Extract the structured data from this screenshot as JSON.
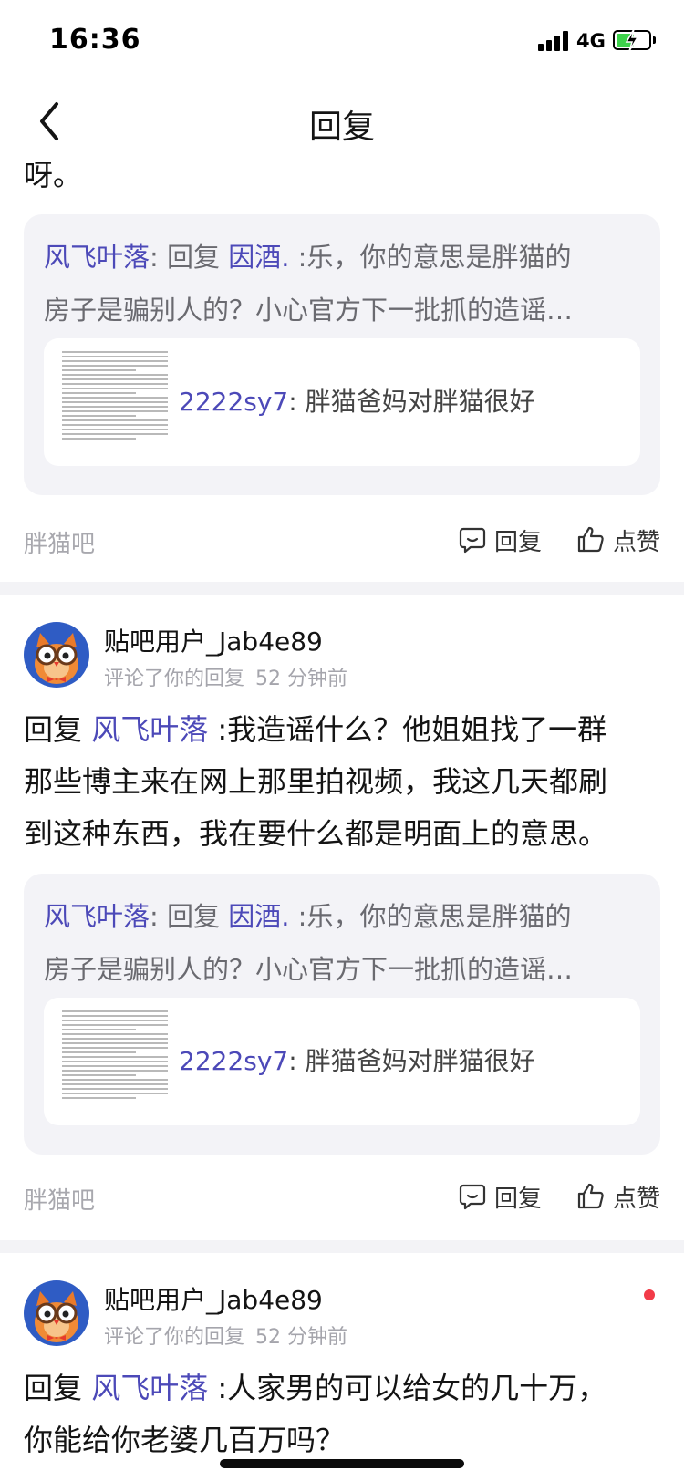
{
  "status_bar": {
    "time": "16:36",
    "network": "4G",
    "battery_level": 0.55
  },
  "nav": {
    "title": "回复"
  },
  "top_partial": {
    "text_fragment": "呀。",
    "quote": {
      "author": "风飞叶落",
      "colon": ":",
      "reply_word": " 回复 ",
      "target": "因酒.",
      "line1_rest": " :乐，你的意思是胖猫的",
      "line2": "房子是骗别人的？小心官方下一批抓的造谣…",
      "nested": {
        "author": "2222sy7",
        "text": ": 胖猫爸妈对胖猫很好"
      }
    },
    "footer": {
      "forum": "胖猫吧",
      "reply": "回复",
      "like": "点赞"
    }
  },
  "notifications": [
    {
      "username": "贴吧用户_Jab4e89",
      "action": "评论了你的回复",
      "time": "52 分钟前",
      "reply_prefix": "回复 ",
      "reply_to": "风飞叶落",
      "line1": " :我造谣什么？他姐姐找了一群",
      "line2": "那些博主来在网上那里拍视频，我这几天都刷",
      "line3": "到这种东西，我在要什么都是明面上的意思。",
      "quote": {
        "author": "风飞叶落",
        "colon": ":",
        "reply_word": " 回复 ",
        "target": "因酒.",
        "line1_rest": " :乐，你的意思是胖猫的",
        "line2": "房子是骗别人的？小心官方下一批抓的造谣…",
        "nested": {
          "author": "2222sy7",
          "text": ": 胖猫爸妈对胖猫很好"
        }
      },
      "footer": {
        "forum": "胖猫吧",
        "reply": "回复",
        "like": "点赞"
      }
    },
    {
      "username": "贴吧用户_Jab4e89",
      "action": "评论了你的回复",
      "time": "52 分钟前",
      "unread": true,
      "reply_prefix": "回复 ",
      "reply_to": "风飞叶落",
      "line1": " :人家男的可以给女的几十万，",
      "line2": "你能给你老婆几百万吗？"
    }
  ],
  "colors": {
    "accent": "#4c49b8",
    "background": "#f3f3f6",
    "unread_dot": "#f23b48"
  }
}
